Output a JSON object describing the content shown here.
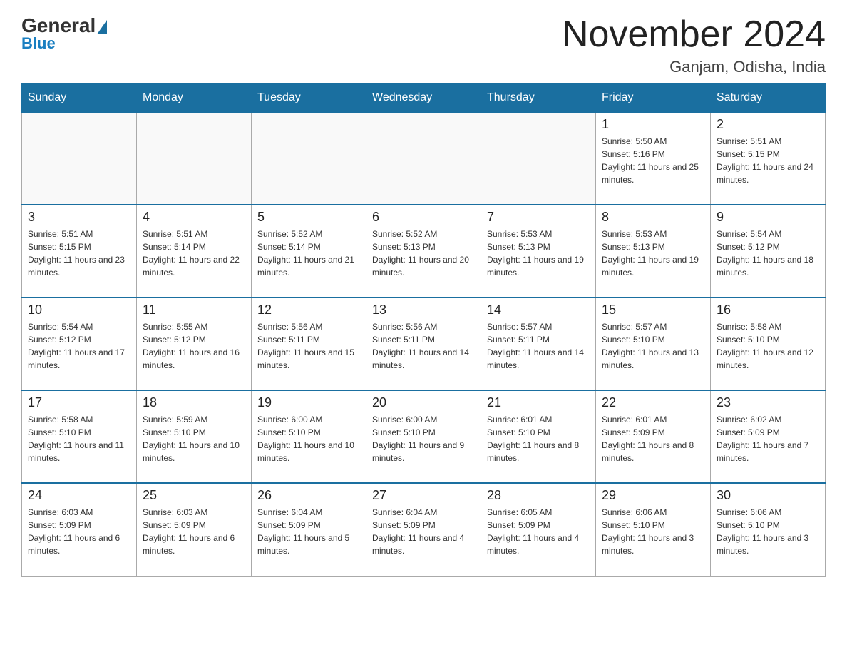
{
  "header": {
    "logo": {
      "general": "General",
      "blue": "Blue"
    },
    "title": "November 2024",
    "location": "Ganjam, Odisha, India"
  },
  "weekdays": [
    "Sunday",
    "Monday",
    "Tuesday",
    "Wednesday",
    "Thursday",
    "Friday",
    "Saturday"
  ],
  "weeks": [
    [
      {
        "day": "",
        "empty": true
      },
      {
        "day": "",
        "empty": true
      },
      {
        "day": "",
        "empty": true
      },
      {
        "day": "",
        "empty": true
      },
      {
        "day": "",
        "empty": true
      },
      {
        "day": "1",
        "sunrise": "5:50 AM",
        "sunset": "5:16 PM",
        "daylight": "11 hours and 25 minutes."
      },
      {
        "day": "2",
        "sunrise": "5:51 AM",
        "sunset": "5:15 PM",
        "daylight": "11 hours and 24 minutes."
      }
    ],
    [
      {
        "day": "3",
        "sunrise": "5:51 AM",
        "sunset": "5:15 PM",
        "daylight": "11 hours and 23 minutes."
      },
      {
        "day": "4",
        "sunrise": "5:51 AM",
        "sunset": "5:14 PM",
        "daylight": "11 hours and 22 minutes."
      },
      {
        "day": "5",
        "sunrise": "5:52 AM",
        "sunset": "5:14 PM",
        "daylight": "11 hours and 21 minutes."
      },
      {
        "day": "6",
        "sunrise": "5:52 AM",
        "sunset": "5:13 PM",
        "daylight": "11 hours and 20 minutes."
      },
      {
        "day": "7",
        "sunrise": "5:53 AM",
        "sunset": "5:13 PM",
        "daylight": "11 hours and 19 minutes."
      },
      {
        "day": "8",
        "sunrise": "5:53 AM",
        "sunset": "5:13 PM",
        "daylight": "11 hours and 19 minutes."
      },
      {
        "day": "9",
        "sunrise": "5:54 AM",
        "sunset": "5:12 PM",
        "daylight": "11 hours and 18 minutes."
      }
    ],
    [
      {
        "day": "10",
        "sunrise": "5:54 AM",
        "sunset": "5:12 PM",
        "daylight": "11 hours and 17 minutes."
      },
      {
        "day": "11",
        "sunrise": "5:55 AM",
        "sunset": "5:12 PM",
        "daylight": "11 hours and 16 minutes."
      },
      {
        "day": "12",
        "sunrise": "5:56 AM",
        "sunset": "5:11 PM",
        "daylight": "11 hours and 15 minutes."
      },
      {
        "day": "13",
        "sunrise": "5:56 AM",
        "sunset": "5:11 PM",
        "daylight": "11 hours and 14 minutes."
      },
      {
        "day": "14",
        "sunrise": "5:57 AM",
        "sunset": "5:11 PM",
        "daylight": "11 hours and 14 minutes."
      },
      {
        "day": "15",
        "sunrise": "5:57 AM",
        "sunset": "5:10 PM",
        "daylight": "11 hours and 13 minutes."
      },
      {
        "day": "16",
        "sunrise": "5:58 AM",
        "sunset": "5:10 PM",
        "daylight": "11 hours and 12 minutes."
      }
    ],
    [
      {
        "day": "17",
        "sunrise": "5:58 AM",
        "sunset": "5:10 PM",
        "daylight": "11 hours and 11 minutes."
      },
      {
        "day": "18",
        "sunrise": "5:59 AM",
        "sunset": "5:10 PM",
        "daylight": "11 hours and 10 minutes."
      },
      {
        "day": "19",
        "sunrise": "6:00 AM",
        "sunset": "5:10 PM",
        "daylight": "11 hours and 10 minutes."
      },
      {
        "day": "20",
        "sunrise": "6:00 AM",
        "sunset": "5:10 PM",
        "daylight": "11 hours and 9 minutes."
      },
      {
        "day": "21",
        "sunrise": "6:01 AM",
        "sunset": "5:10 PM",
        "daylight": "11 hours and 8 minutes."
      },
      {
        "day": "22",
        "sunrise": "6:01 AM",
        "sunset": "5:09 PM",
        "daylight": "11 hours and 8 minutes."
      },
      {
        "day": "23",
        "sunrise": "6:02 AM",
        "sunset": "5:09 PM",
        "daylight": "11 hours and 7 minutes."
      }
    ],
    [
      {
        "day": "24",
        "sunrise": "6:03 AM",
        "sunset": "5:09 PM",
        "daylight": "11 hours and 6 minutes."
      },
      {
        "day": "25",
        "sunrise": "6:03 AM",
        "sunset": "5:09 PM",
        "daylight": "11 hours and 6 minutes."
      },
      {
        "day": "26",
        "sunrise": "6:04 AM",
        "sunset": "5:09 PM",
        "daylight": "11 hours and 5 minutes."
      },
      {
        "day": "27",
        "sunrise": "6:04 AM",
        "sunset": "5:09 PM",
        "daylight": "11 hours and 4 minutes."
      },
      {
        "day": "28",
        "sunrise": "6:05 AM",
        "sunset": "5:09 PM",
        "daylight": "11 hours and 4 minutes."
      },
      {
        "day": "29",
        "sunrise": "6:06 AM",
        "sunset": "5:10 PM",
        "daylight": "11 hours and 3 minutes."
      },
      {
        "day": "30",
        "sunrise": "6:06 AM",
        "sunset": "5:10 PM",
        "daylight": "11 hours and 3 minutes."
      }
    ]
  ]
}
